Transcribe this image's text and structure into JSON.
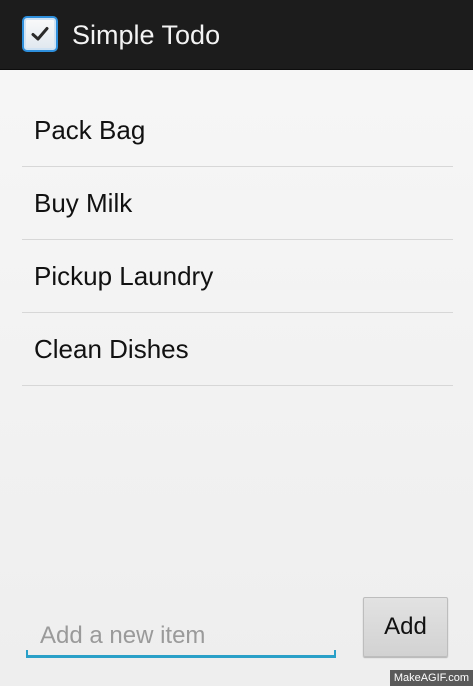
{
  "action_bar": {
    "title": "Simple Todo",
    "icon": "checkbox-checked-icon"
  },
  "todo_items": [
    {
      "label": "Pack Bag"
    },
    {
      "label": "Buy Milk"
    },
    {
      "label": "Pickup Laundry"
    },
    {
      "label": "Clean Dishes"
    }
  ],
  "new_item": {
    "value": "",
    "placeholder": "Add a new item"
  },
  "add_button": {
    "label": "Add"
  },
  "watermark": {
    "text": "MakeAGIF.com"
  },
  "colors": {
    "action_bar_bg": "#1c1c1c",
    "accent": "#2aa0c8",
    "icon_border": "#2e8fdc",
    "divider": "#d7d7d7"
  }
}
